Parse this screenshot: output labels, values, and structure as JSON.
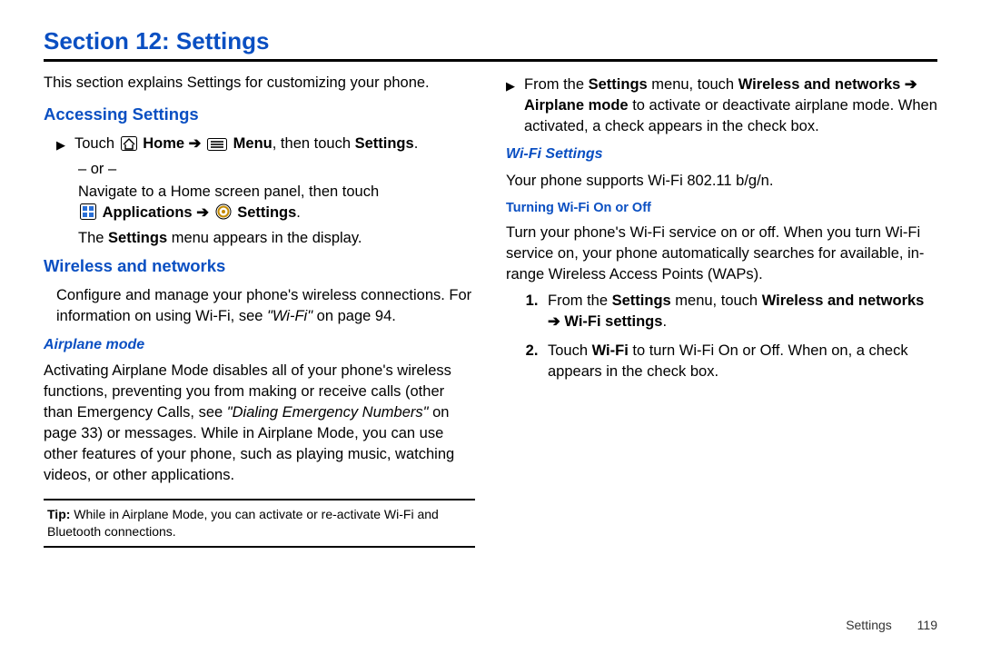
{
  "section_title": "Section 12: Settings",
  "intro": "This section explains Settings for customizing your phone.",
  "left": {
    "h_accessing": "Accessing Settings",
    "step1_pre": "Touch ",
    "step1_home": "Home",
    "step1_arrow": " ➔ ",
    "step1_menu": "Menu",
    "step1_post": ", then touch ",
    "step1_settings": "Settings",
    "step1_end": ".",
    "or": "– or –",
    "nav_line1": "Navigate to a Home screen panel, then touch",
    "apps_label": "Applications",
    "arrow2": " ➔ ",
    "settings_label": "Settings",
    "nav_end": ".",
    "menu_appears_pre": "The ",
    "menu_appears_bold": "Settings",
    "menu_appears_post": " menu appears in the display.",
    "h_wireless": "Wireless and networks",
    "wireless_para_a": "Configure and manage your phone's wireless connections. For information on using Wi-Fi, see ",
    "wireless_link": "\"Wi-Fi\"",
    "wireless_para_b": " on page 94.",
    "h_airplane": "Airplane mode",
    "airplane_para_a": "Activating Airplane Mode disables all of your phone's wireless functions, preventing you from making or receive calls (other than Emergency Calls, see ",
    "airplane_link": "\"Dialing Emergency Numbers\"",
    "airplane_para_b": " on page 33) or messages. While in Airplane Mode, you can use other features of your phone, such as playing music, watching videos, or other applications.",
    "tip_label": "Tip:",
    "tip_text": " While in Airplane Mode, you can activate or re-activate Wi-Fi and Bluetooth connections."
  },
  "right": {
    "r1_pre": "From the ",
    "r1_settings": "Settings",
    "r1_mid": " menu, touch ",
    "r1_wn": "Wireless and networks ➔ Airplane mode",
    "r1_post": " to activate or deactivate airplane mode. When activated, a check appears in the check box.",
    "h_wifi": "Wi-Fi Settings",
    "wifi_support": "Your phone supports Wi-Fi 802.11 b/g/n.",
    "h_turning": "Turning Wi-Fi On or Off",
    "turning_para": "Turn your phone's Wi-Fi service on or off. When you turn Wi-Fi service on, your phone automatically searches for available, in-range Wireless Access Points (WAPs).",
    "ol1_pre": "From the ",
    "ol1_settings": "Settings",
    "ol1_mid": " menu, touch ",
    "ol1_wn": "Wireless and networks ➔ Wi-Fi settings",
    "ol1_end": ".",
    "ol2_pre": "Touch ",
    "ol2_wifi": "Wi-Fi",
    "ol2_post": " to turn Wi-Fi On or Off. When on, a check appears in the check box."
  },
  "footer": {
    "label": "Settings",
    "page": "119"
  }
}
